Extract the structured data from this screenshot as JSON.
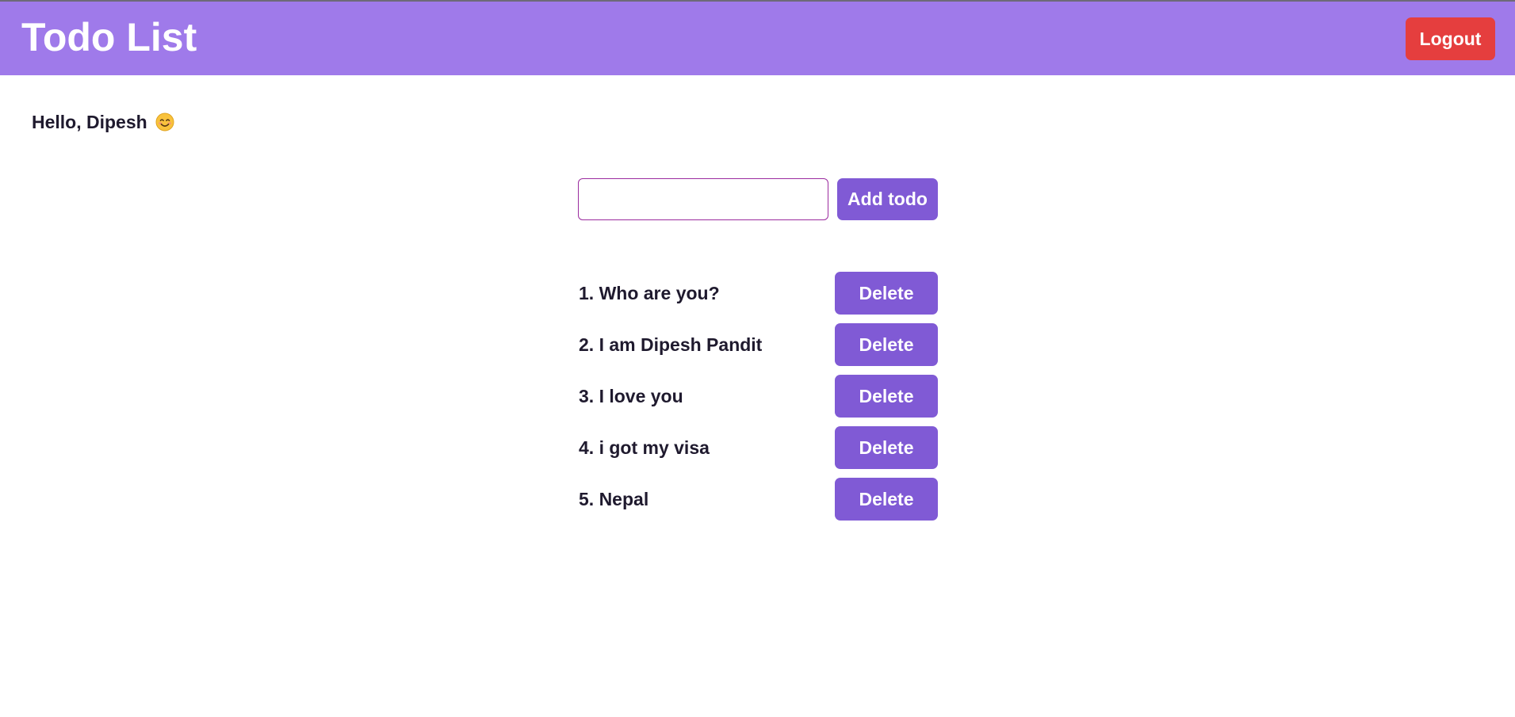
{
  "header": {
    "title": "Todo List",
    "logout_label": "Logout"
  },
  "greeting": {
    "text": "Hello, Dipesh",
    "emoji": "smiling-face-icon"
  },
  "new_todo": {
    "value": "",
    "placeholder": "",
    "add_label": "Add todo"
  },
  "todos": [
    {
      "text": "1. Who are you?",
      "delete_label": "Delete"
    },
    {
      "text": "2. I am Dipesh Pandit",
      "delete_label": "Delete"
    },
    {
      "text": "3. I love you",
      "delete_label": "Delete"
    },
    {
      "text": "4. i got my visa",
      "delete_label": "Delete"
    },
    {
      "text": "5. Nepal",
      "delete_label": "Delete"
    }
  ],
  "colors": {
    "header_bg": "#9f7aea",
    "primary": "#805ad5",
    "danger": "#e53e3e",
    "input_border": "#9b2c9f"
  }
}
